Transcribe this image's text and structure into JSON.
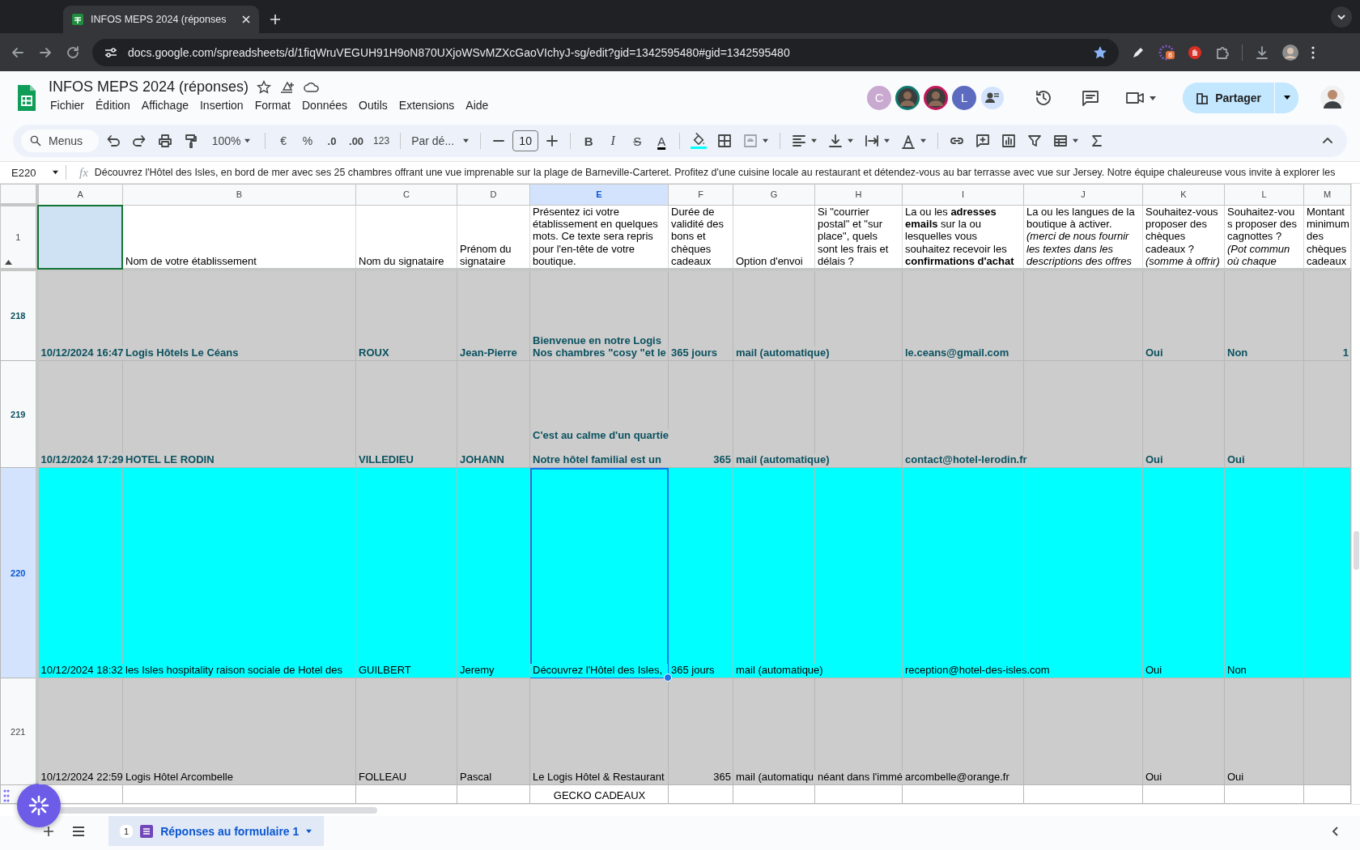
{
  "browser": {
    "tab_title": "INFOS MEPS 2024 (réponses",
    "url": "docs.google.com/spreadsheets/d/1fiqWruVEGUH91H9oN870UXjoWSvMZXcGaoVIchyJ-sg/edit?gid=1342595480#gid=1342595480",
    "extension_badge": "8"
  },
  "document": {
    "title": "INFOS MEPS 2024 (réponses)",
    "menus": [
      "Fichier",
      "Édition",
      "Affichage",
      "Insertion",
      "Format",
      "Données",
      "Outils",
      "Extensions",
      "Aide"
    ],
    "collaborators": [
      {
        "kind": "letter",
        "letter": "C",
        "color": "#c9a9cf"
      },
      {
        "kind": "photo",
        "color": "#0f766e"
      },
      {
        "kind": "photo",
        "color": "#c2185b"
      },
      {
        "kind": "letter",
        "letter": "L",
        "color": "#5c6bc0"
      }
    ],
    "share_label": "Partager"
  },
  "toolbar": {
    "search": "Menus",
    "zoom": "100%",
    "currency": "€",
    "percent": "%",
    "decrease_decimals": ".0",
    "increase_decimals": ".00",
    "number_format": "123",
    "font": "Par dé...",
    "font_size": "10",
    "bold": "B",
    "italic": "I",
    "strikethrough": "S",
    "text_color": "A"
  },
  "formula_bar": {
    "cell": "E220",
    "label": "fx",
    "content": "Découvrez l'Hôtel des Isles, en bord de mer avec ses 25 chambres offrant une vue imprenable sur la plage de Barneville-Carteret. Profitez d'une cuisine locale au restaurant et détendez-vous au bar terrasse avec vue sur Jersey. Notre équipe chaleureuse vous invite à explorer les"
  },
  "columns": [
    {
      "letter": "A",
      "selected": false
    },
    {
      "letter": "B",
      "selected": false
    },
    {
      "letter": "C",
      "selected": false
    },
    {
      "letter": "D",
      "selected": false
    },
    {
      "letter": "E",
      "selected": true
    },
    {
      "letter": "F",
      "selected": false
    },
    {
      "letter": "G",
      "selected": false
    },
    {
      "letter": "H",
      "selected": false
    },
    {
      "letter": "I",
      "selected": false
    },
    {
      "letter": "J",
      "selected": false
    },
    {
      "letter": "K",
      "selected": false
    },
    {
      "letter": "L",
      "selected": false
    },
    {
      "letter": "M",
      "selected": false
    }
  ],
  "header_row": {
    "number": "1",
    "cells": [
      {
        "cursor": true
      },
      "Nom de votre établissement",
      "Nom du signataire",
      "Prénom du\nsignataire",
      "Présentez ici votre\nétablissement en quelques\nmots. Ce texte sera repris\npour l'en-tête de votre\nboutique.",
      "Durée de\nvalidité des\nbons et\nchèques\ncadeaux",
      "Option d'envoi",
      "Si \"courrier\npostal\" et \"sur\nplace\", quels\nsont les frais et\ndélais ?",
      "La ou les **adresses**\n**emails** sur la ou\nlesquelles vous\nsouhaitez recevoir les\n**confirmations d'achat**",
      "La ou les langues de la\nboutique à activer.\n*(merci de nous fournir*\n*les textes dans les*\n*descriptions des offres*",
      "Souhaitez-vous\nproposer des\nchèques\ncadeaux ?\n*(somme à offrir)*",
      "Souhaitez-vou\ns proposer des\ncagnottes ?\n*(Pot commun*\n*où chaque*",
      "Montant\nminimum\ndes\nchèques\ncadeaux"
    ]
  },
  "rows": [
    {
      "number": "218",
      "selected": false,
      "bold": true,
      "color": "#cccccc",
      "cells": [
        "10/12/2024 16:47",
        "Logis Hôtels Le Céans",
        "ROUX",
        "Jean-Pierre",
        "Bienvenue en notre Logis\nNos chambres \"cosy \"et le",
        "365 jours",
        "mail (automatique)",
        null,
        "le.ceans@gmail.com",
        null,
        "Oui",
        "Non",
        {
          "text": "1",
          "kind": "number"
        }
      ]
    },
    {
      "number": "219",
      "selected": false,
      "bold": true,
      "color": "#cccccc",
      "cells": [
        "10/12/2024 17:29",
        "HOTEL LE RODIN",
        "VILLEDIEU",
        "JOHANN",
        "C'est au calme d'un quartie\n\nNotre hôtel familial est un",
        {
          "text": "365",
          "kind": "number"
        },
        "mail (automatique)",
        null,
        "contact@hotel-lerodin.fr",
        null,
        "Oui",
        "Oui",
        null
      ]
    },
    {
      "number": "220",
      "selected": true,
      "bold": false,
      "color": "#00ffff",
      "cells": [
        "10/12/2024 18:32",
        "les Isles hospitality raison sociale de Hotel des",
        "GUILBERT",
        "Jeremy",
        "Découvrez l'Hôtel des Isles,",
        "365 jours",
        "mail (automatique)",
        null,
        "reception@hotel-des-isles.com",
        null,
        "Oui",
        "Non",
        null
      ]
    },
    {
      "number": "221",
      "selected": false,
      "bold": false,
      "color": "#cccccc",
      "cells": [
        "10/12/2024 22:59",
        "Logis Hôtel Arcombelle",
        "FOLLEAU",
        "Pascal",
        "Le Logis Hôtel & Restaurant",
        {
          "text": "365",
          "kind": "number"
        },
        "mail (automatiqu",
        "néant dans l'immé",
        "arcombelle@orange.fr",
        null,
        "Oui",
        "Oui",
        null
      ]
    },
    {
      "selected": false,
      "bold": false,
      "color": "#ffffff",
      "cells": [
        null,
        null,
        null,
        null,
        {
          "text": "GECKO CADEAUX",
          "kind": "centered"
        },
        null,
        null,
        null,
        null,
        null,
        null,
        null,
        null
      ]
    }
  ],
  "sheet_tabs": [
    {
      "count": "1",
      "label": "Réponses au formulaire 1",
      "selected": true
    }
  ]
}
